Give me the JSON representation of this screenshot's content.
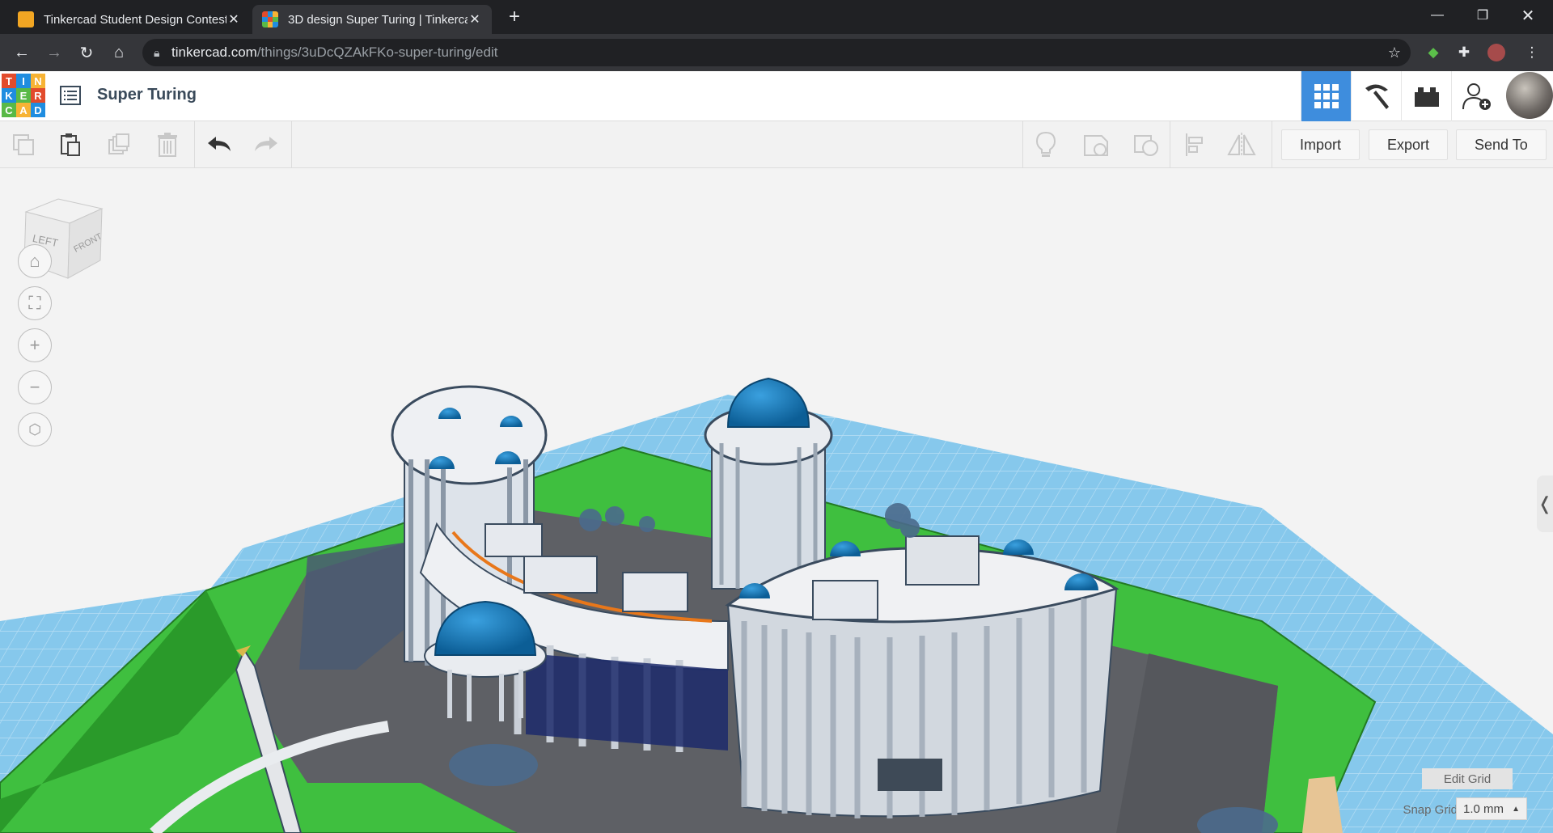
{
  "browser": {
    "tabs": [
      {
        "title": "Tinkercad Student Design Contest",
        "active": false
      },
      {
        "title": "3D design Super Turing | Tinkercad",
        "active": true
      }
    ],
    "new_tab": "+",
    "url_host": "tinkercad.com",
    "url_path": "/things/3uDcQZAkFKo-super-turing/edit"
  },
  "app": {
    "logo_letters": [
      "T",
      "I",
      "N",
      "K",
      "E",
      "R",
      "C",
      "A",
      "D"
    ],
    "design_title": "Super Turing"
  },
  "toolbar": {
    "import_label": "Import",
    "export_label": "Export",
    "send_to_label": "Send To"
  },
  "viewcube": {
    "left_face": "LEFT",
    "front_face": "FRONT"
  },
  "grid": {
    "edit_grid_label": "Edit Grid",
    "snap_grid_label": "Snap Grid",
    "snap_grid_value": "1.0 mm"
  },
  "colors": {
    "grass": "#3fbf3f",
    "grid_blue": "#7fc4ea",
    "building_white": "#f0f1f2",
    "dome_blue": "#1877b5",
    "road": "#5e6065",
    "header_active": "#3e8ddd"
  }
}
